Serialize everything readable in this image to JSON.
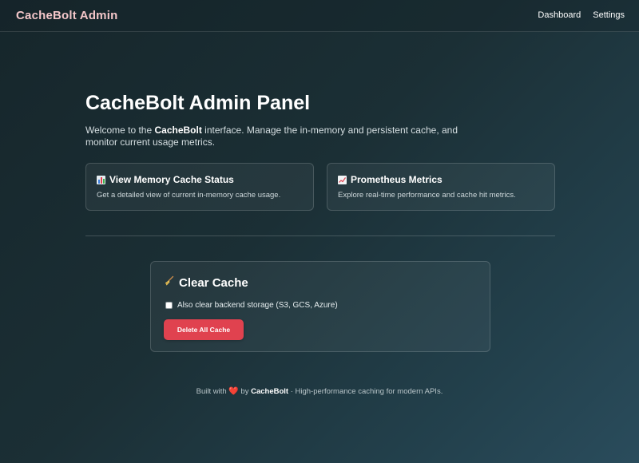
{
  "navbar": {
    "brand": "CacheBolt Admin",
    "links": [
      "Dashboard",
      "Settings"
    ]
  },
  "main": {
    "title": "CacheBolt Admin Panel",
    "intro_prefix": "Welcome to the ",
    "intro_brand": "CacheBolt",
    "intro_suffix": " interface. Manage the in-memory and persistent cache, and monitor current usage metrics."
  },
  "cards": [
    {
      "icon": "bar-chart-icon",
      "title": "View Memory Cache Status",
      "description": "Get a detailed view of current in-memory cache usage."
    },
    {
      "icon": "line-chart-icon",
      "title": "Prometheus Metrics",
      "description": "Explore real-time performance and cache hit metrics."
    }
  ],
  "clear_cache": {
    "icon": "broom-icon",
    "title": "Clear Cache",
    "checkbox_label": "Also clear backend storage (S3, GCS, Azure)",
    "checkbox_checked": false,
    "button_label": "Delete All Cache"
  },
  "footer": {
    "prefix": "Built with",
    "heart": "❤️",
    "by": "by",
    "brand": "CacheBolt",
    "suffix": "· High-performance caching for modern APIs."
  },
  "colors": {
    "brand": "#f3c6c9",
    "danger": "#e0424f"
  }
}
